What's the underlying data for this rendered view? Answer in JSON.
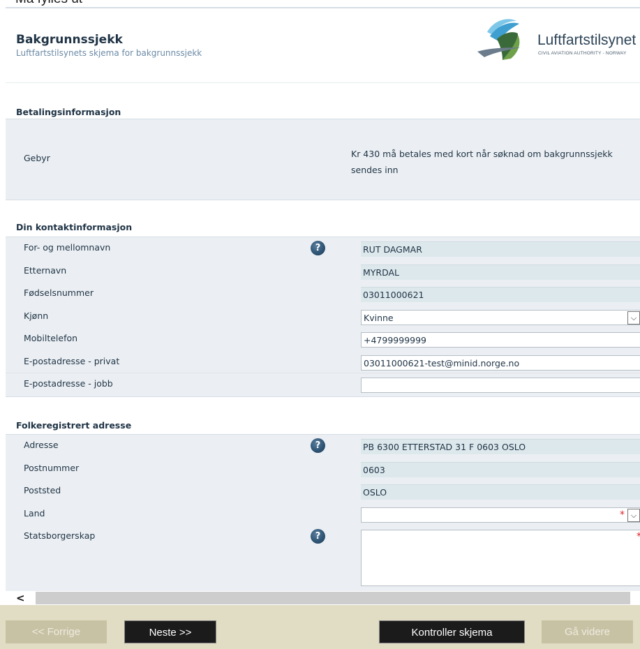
{
  "top_clip_text": "Må fylles ut",
  "header": {
    "title": "Bakgrunnssjekk",
    "subtitle": "Luftfartstilsynets skjema for bakgrunnssjekk",
    "logo_text": "Luftfartstilsynet",
    "logo_sub": "CIVIL AVIATION AUTHORITY - NORWAY"
  },
  "payment": {
    "section_title": "Betalingsinformasjon",
    "fee_label": "Gebyr",
    "fee_text": "Kr 430 må betales med kort når søknad om bakgrunnssjekk sendes inn"
  },
  "contact": {
    "section_title": "Din kontaktinformasjon",
    "first_name_label": "For- og mellomnavn",
    "first_name_value": "RUT DAGMAR",
    "last_name_label": "Etternavn",
    "last_name_value": "MYRDAL",
    "ssn_label": "Fødselsnummer",
    "ssn_value": "03011000621",
    "gender_label": "Kjønn",
    "gender_value": "Kvinne",
    "mobile_label": "Mobiltelefon",
    "mobile_value": "+4799999999",
    "email_private_label": "E-postadresse - privat",
    "email_private_value": "03011000621-test@minid.norge.no",
    "email_work_label": "E-postadresse - jobb",
    "email_work_value": ""
  },
  "address": {
    "section_title": "Folkeregistrert adresse",
    "address_label": "Adresse",
    "address_value": "PB 6300 ETTERSTAD 31 F 0603 OSLO",
    "postcode_label": "Postnummer",
    "postcode_value": "0603",
    "city_label": "Poststed",
    "city_value": "OSLO",
    "country_label": "Land",
    "country_value": "",
    "citizenship_label": "Statsborgerskap"
  },
  "icons": {
    "help": "?",
    "required": "*",
    "dropdown": "⌵",
    "scroll_left": "<"
  },
  "footer": {
    "prev": "<< Forrige",
    "next": "Neste >>",
    "validate": "Kontroller skjema",
    "proceed": "Gå videre"
  },
  "colors": {
    "section_bg": "#ebeff3",
    "readonly_field_bg": "#dde8ec",
    "footer_bg": "#e1dcc4",
    "button_dark": "#1b1b1b",
    "button_disabled": "#c8c2a5",
    "help_icon": "#2f5575",
    "required": "#e0242a"
  }
}
